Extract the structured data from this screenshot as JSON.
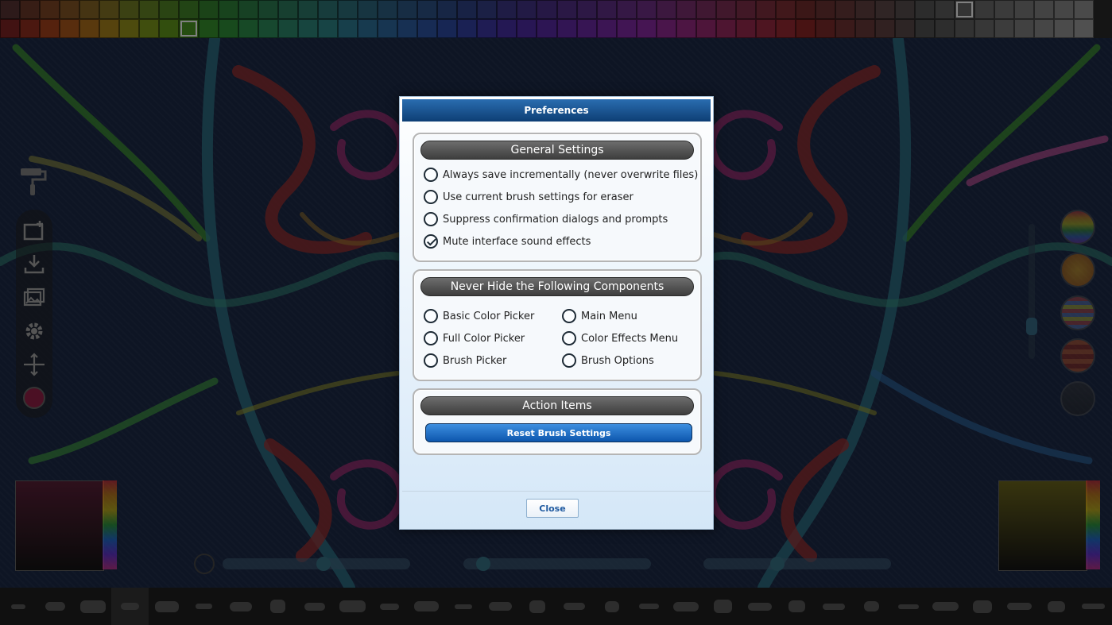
{
  "palette": {
    "top_row_colors": [
      "#4a2a2a",
      "#5a2f22",
      "#6a3a20",
      "#6e4820",
      "#705520",
      "#6e6020",
      "#606a20",
      "#546e20",
      "#456e20",
      "#376e22",
      "#2d6c28",
      "#286c30",
      "#266a3a",
      "#266844",
      "#26664e",
      "#266458",
      "#266262",
      "#265c66",
      "#26566a",
      "#26506c",
      "#264a6e",
      "#264470",
      "#263e70",
      "#283870",
      "#2c3470",
      "#322e70",
      "#382a70",
      "#3e2870",
      "#442870",
      "#4a2870",
      "#502870",
      "#562870",
      "#5c2870",
      "#622866",
      "#66285c",
      "#682852",
      "#6a2848",
      "#6a283e",
      "#6a2834",
      "#6a282c",
      "#602626",
      "#5a2a2a",
      "#563030",
      "#523636",
      "#4e3c3c",
      "#4a4242",
      "#484848",
      "#4e4e4e",
      "#545454",
      "#5a5a5a",
      "#606060",
      "#666666",
      "#6c6c6c",
      "#727272",
      "#787878"
    ],
    "bottom_row_colors": [
      "#6a1e1e",
      "#7a281a",
      "#8a3818",
      "#8e4a18",
      "#905c18",
      "#8c6c18",
      "#7c7a18",
      "#687e18",
      "#527e18",
      "#3e7c1c",
      "#2e7a26",
      "#287830",
      "#26763e",
      "#26744c",
      "#26725a",
      "#267066",
      "#266e70",
      "#26667a",
      "#265e80",
      "#265684",
      "#264e86",
      "#264688",
      "#263e88",
      "#2a3688",
      "#322e88",
      "#3a2888",
      "#422488",
      "#4a2288",
      "#522288",
      "#5a2288",
      "#622288",
      "#6a2288",
      "#722286",
      "#78227a",
      "#7c226c",
      "#7e225e",
      "#7e2250",
      "#7e2242",
      "#7e2236",
      "#7e222a",
      "#742020",
      "#682424",
      "#5e2a2a",
      "#563030",
      "#503636",
      "#4a3c3c",
      "#444444",
      "#4a4a4a",
      "#525252",
      "#5a5a5a",
      "#626262",
      "#6a6a6a",
      "#727272",
      "#7a7a7a",
      "#828282"
    ],
    "selected_top_index": 48,
    "selected_bottom_index": 9
  },
  "right_swatches": [
    {
      "name": "rainbow-swatch",
      "color": "#c84848"
    },
    {
      "name": "orange-swatch",
      "color": "#e09a20"
    },
    {
      "name": "stripe-swatch",
      "color": "#7a7ad0"
    },
    {
      "name": "warm-stripe-swatch",
      "color": "#d06030"
    },
    {
      "name": "eraser-swatch",
      "color": "#555555"
    }
  ],
  "dialog": {
    "title": "Preferences",
    "general": {
      "heading": "General Settings",
      "options": [
        {
          "label": "Always save incrementally (never overwrite files)",
          "checked": false
        },
        {
          "label": "Use current brush settings for eraser",
          "checked": false
        },
        {
          "label": "Suppress confirmation dialogs and prompts",
          "checked": false
        },
        {
          "label": "Mute interface sound effects",
          "checked": true
        }
      ]
    },
    "components": {
      "heading": "Never Hide the Following Components",
      "left": [
        {
          "label": "Basic Color Picker",
          "checked": false
        },
        {
          "label": "Full Color Picker",
          "checked": false
        },
        {
          "label": "Brush Picker",
          "checked": false
        }
      ],
      "right": [
        {
          "label": "Main Menu",
          "checked": false
        },
        {
          "label": "Color Effects Menu",
          "checked": false
        },
        {
          "label": "Brush Options",
          "checked": false
        }
      ]
    },
    "actions": {
      "heading": "Action Items",
      "reset_label": "Reset Brush Settings"
    },
    "close_label": "Close"
  }
}
